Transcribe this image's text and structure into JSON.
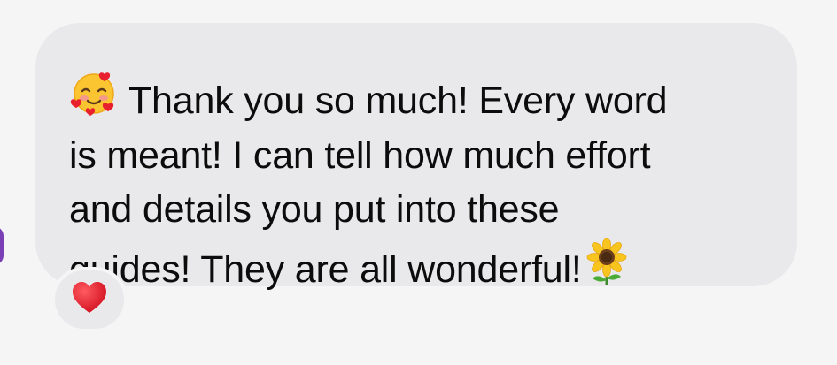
{
  "message": {
    "lead_emoji": "smiling-face-with-hearts-icon",
    "line1": "Thank you so much! Every word",
    "line2": "is meant! I can tell how much effort",
    "line3": "and details you put into these",
    "line4": "guides! They are all wonderful!",
    "trail_emoji": "sunflower-icon"
  },
  "reaction": {
    "emoji": "red-heart-icon"
  },
  "colors": {
    "background": "#f5f5f6",
    "bubble": "#e9e9eb",
    "text": "#0c0c0c",
    "avatar": "#7a3fb5",
    "heart": "#e8202d"
  }
}
